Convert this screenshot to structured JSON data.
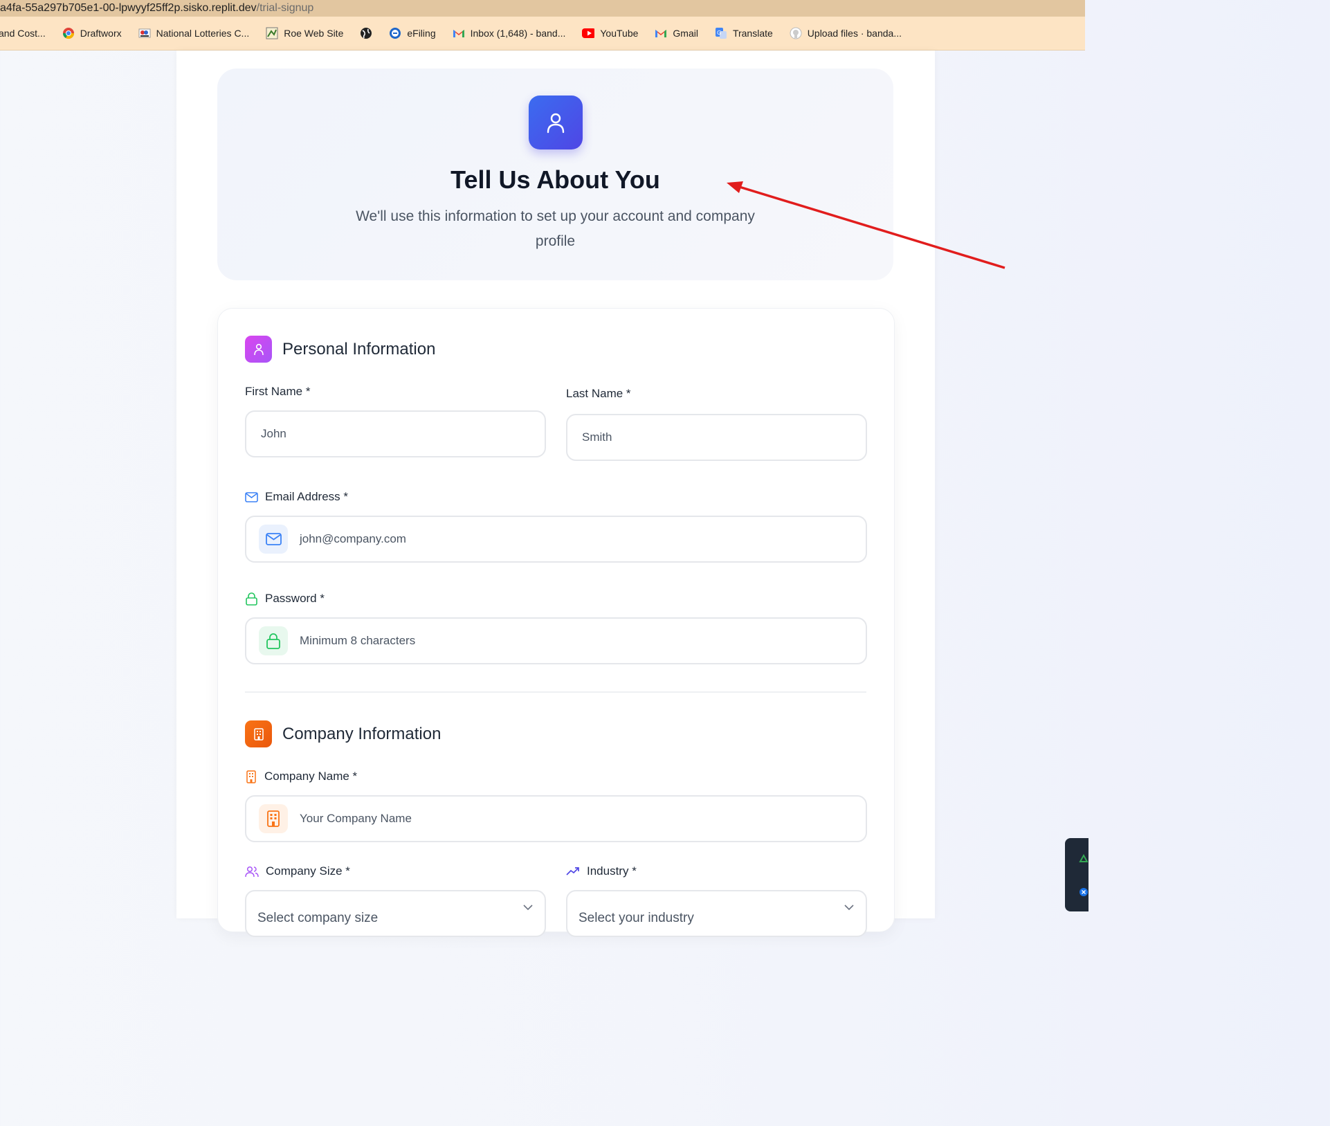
{
  "browser": {
    "url_host": "a4fa-55a297b705e1-00-lpwyyf25ff2p.sisko.replit.dev",
    "url_path": "/trial-signup",
    "bookmarks": [
      {
        "label": "and Cost...",
        "icon": "none"
      },
      {
        "label": "Draftworx",
        "icon": "chrome-like-icon"
      },
      {
        "label": "National Lotteries C...",
        "icon": "nlc-icon"
      },
      {
        "label": "Roe Web Site",
        "icon": "map-icon"
      },
      {
        "label": "",
        "icon": "globe-icon"
      },
      {
        "label": "eFiling",
        "icon": "efiling-icon"
      },
      {
        "label": "Inbox (1,648) - band...",
        "icon": "gmail-icon"
      },
      {
        "label": "YouTube",
        "icon": "youtube-icon"
      },
      {
        "label": "Gmail",
        "icon": "gmail-icon"
      },
      {
        "label": "Translate",
        "icon": "translate-icon"
      },
      {
        "label": "Upload files · banda...",
        "icon": "github-icon"
      }
    ]
  },
  "hero": {
    "title": "Tell Us About You",
    "subtitle": "We'll use this information to set up your account and company profile",
    "icon": "user-icon",
    "accent": "#4f46e5"
  },
  "personal": {
    "title": "Personal Information",
    "first_name_label": "First Name *",
    "first_name_placeholder": "John",
    "last_name_label": "Last Name *",
    "last_name_placeholder": "Smith",
    "email_label": "Email Address *",
    "email_placeholder": "john@company.com",
    "password_label": "Password *",
    "password_placeholder": "Minimum 8 characters"
  },
  "company": {
    "title": "Company Information",
    "name_label": "Company Name *",
    "name_placeholder": "Your Company Name",
    "size_label": "Company Size *",
    "size_placeholder": "Select company size",
    "industry_label": "Industry *",
    "industry_placeholder": "Select your industry"
  },
  "colors": {
    "email": "#3b82f6",
    "password": "#22c55e",
    "company": "#f97316",
    "size": "#a855f7",
    "industry": "#4f46e5",
    "annotation_arrow": "#e11d1d"
  }
}
